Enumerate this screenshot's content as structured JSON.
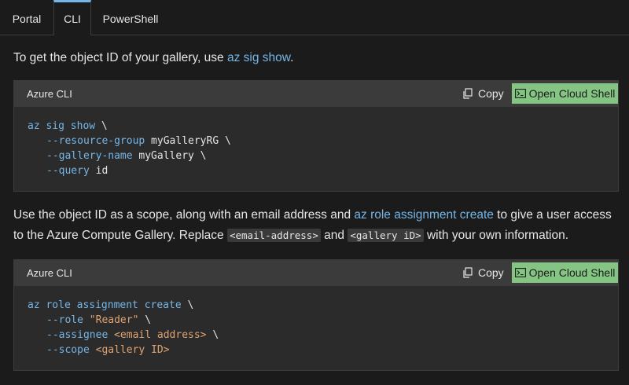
{
  "tabs": [
    {
      "label": "Portal"
    },
    {
      "label": "CLI"
    },
    {
      "label": "PowerShell"
    }
  ],
  "intro": {
    "prefix": "To get the object ID of your gallery, use ",
    "link": "az sig show",
    "suffix": "."
  },
  "block1": {
    "lang": "Azure CLI",
    "copy_label": "Copy",
    "shell_label": "Open Cloud Shell",
    "lines": [
      {
        "cmd": "az sig show",
        "rest": " \\"
      },
      {
        "param": "--resource-group",
        "value": " myGalleryRG \\"
      },
      {
        "param": "--gallery-name",
        "value": " myGallery \\"
      },
      {
        "param": "--query",
        "value": " id"
      }
    ]
  },
  "para2": {
    "p1": "Use the object ID as a scope, along with an email address and ",
    "link": "az role assignment create",
    "p2": " to give a user access",
    "p3": "to the Azure Compute Gallery. Replace ",
    "code1": "<email-address>",
    "p4": " and ",
    "code2": "<gallery iD>",
    "p5": " with your own information."
  },
  "block2": {
    "lang": "Azure CLI",
    "copy_label": "Copy",
    "shell_label": "Open Cloud Shell",
    "lines": [
      {
        "cmd": "az role assignment create",
        "rest": " \\"
      },
      {
        "param": "--role",
        "value": " ",
        "str": "\"Reader\"",
        "tail": " \\"
      },
      {
        "param": "--assignee",
        "value": " ",
        "str": "<email address>",
        "tail": " \\"
      },
      {
        "param": "--scope",
        "value": " ",
        "str": "<gallery ID>",
        "tail": ""
      }
    ]
  },
  "colors": {
    "background": "#1b1b1b",
    "code_bg": "#2b2b2b",
    "header_bg": "#3b3b3b",
    "accent": "#75b6e7",
    "shell_button": "#84c583",
    "string": "#e0a370"
  }
}
